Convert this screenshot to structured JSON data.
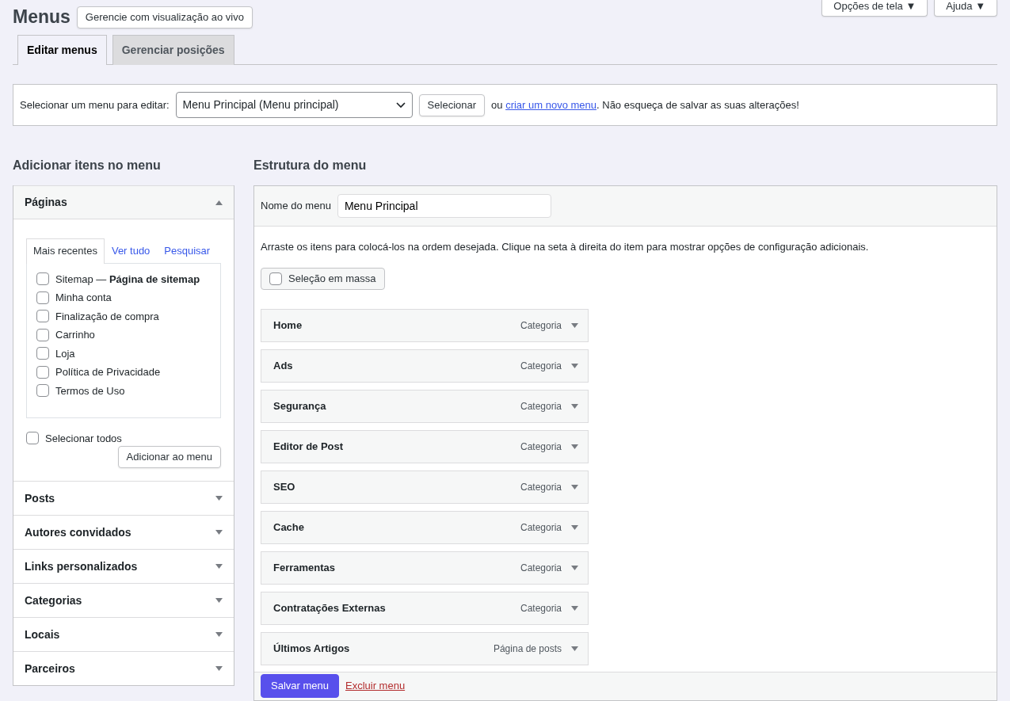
{
  "header": {
    "title": "Menus",
    "live_button": "Gerencie com visualização ao vivo",
    "screen_options": {
      "label": "Opções de tela",
      "caret": "▼"
    },
    "help": {
      "label": "Ajuda",
      "caret": "▼"
    }
  },
  "tabs": [
    {
      "label": "Editar menus",
      "selected": true
    },
    {
      "label": "Gerenciar posições",
      "selected": false
    }
  ],
  "menu_select": {
    "label": "Selecionar um menu para editar:",
    "value": "Menu Principal (Menu principal)",
    "button": "Selecionar",
    "text_before": "ou ",
    "link": "criar um novo menu",
    "text_after": ". Não esqueça de salvar as suas alterações!"
  },
  "add_items": {
    "heading": "Adicionar itens no menu",
    "sections": [
      {
        "title": "Páginas",
        "expanded": true,
        "tabs": [
          {
            "label": "Mais recentes",
            "selected": true
          },
          {
            "label": "Ver tudo",
            "selected": false
          },
          {
            "label": "Pesquisar",
            "selected": false
          }
        ],
        "items": [
          {
            "label": "Sitemap — **Página de sitemap**",
            "checked": false
          },
          {
            "label": "Minha conta",
            "checked": false
          },
          {
            "label": "Finalização de compra",
            "checked": false
          },
          {
            "label": "Carrinho",
            "checked": false
          },
          {
            "label": "Loja",
            "checked": false
          },
          {
            "label": "Política de Privacidade",
            "checked": false
          },
          {
            "label": "Termos de Uso",
            "checked": false
          }
        ],
        "select_all": {
          "label": "Selecionar todos",
          "checked": false
        },
        "add_button": "Adicionar ao menu"
      },
      {
        "title": "Posts",
        "expanded": false
      },
      {
        "title": "Autores convidados",
        "expanded": false
      },
      {
        "title": "Links personalizados",
        "expanded": false
      },
      {
        "title": "Categorias",
        "expanded": false
      },
      {
        "title": "Locais",
        "expanded": false
      },
      {
        "title": "Parceiros",
        "expanded": false
      }
    ]
  },
  "structure": {
    "heading": "Estrutura do menu",
    "name_label": "Nome do menu",
    "name_value": "Menu Principal",
    "instructions": "Arraste os itens para colocá-los na ordem desejada. Clique na seta à direita do item para mostrar opções de configuração adicionais.",
    "bulk_select": {
      "label": "Seleção em massa",
      "checked": false
    },
    "items": [
      {
        "title": "Home",
        "type": "Categoria",
        "expanded": false
      },
      {
        "title": "Ads",
        "type": "Categoria",
        "expanded": false
      },
      {
        "title": "Segurança",
        "type": "Categoria",
        "expanded": false
      },
      {
        "title": "Editor de Post",
        "type": "Categoria",
        "expanded": false
      },
      {
        "title": "SEO",
        "type": "Categoria",
        "expanded": false
      },
      {
        "title": "Cache",
        "type": "Categoria",
        "expanded": false
      },
      {
        "title": "Ferramentas",
        "type": "Categoria",
        "expanded": false
      },
      {
        "title": "Contratações Externas",
        "type": "Categoria",
        "expanded": false
      },
      {
        "title": "Últimos Artigos",
        "type": "Página de posts",
        "expanded": false
      }
    ],
    "save_button": "Salvar menu",
    "delete_link": "Excluir menu"
  }
}
